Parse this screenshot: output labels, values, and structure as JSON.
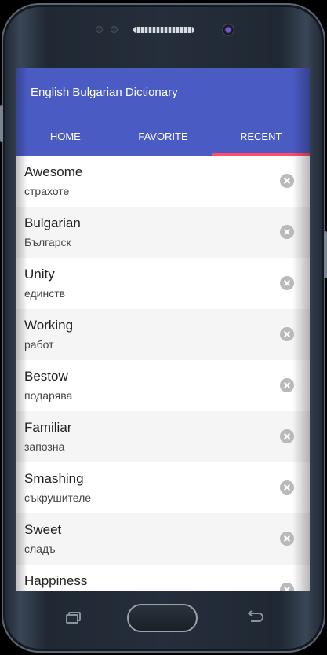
{
  "app": {
    "title": "English Bulgarian Dictionary"
  },
  "tabs": [
    {
      "label": "HOME",
      "active": false
    },
    {
      "label": "FAVORITE",
      "active": false
    },
    {
      "label": "RECENT",
      "active": true
    }
  ],
  "recent": [
    {
      "word": "Awesome",
      "translation": "страхоте"
    },
    {
      "word": "Bulgarian",
      "translation": "Българск"
    },
    {
      "word": "Unity",
      "translation": "единств"
    },
    {
      "word": "Working",
      "translation": "работ"
    },
    {
      "word": "Bestow",
      "translation": "подарява"
    },
    {
      "word": "Familiar",
      "translation": "запозна"
    },
    {
      "word": "Smashing",
      "translation": "съкрушителе"
    },
    {
      "word": "Sweet",
      "translation": "сладъ"
    },
    {
      "word": "Happiness",
      "translation": ""
    }
  ],
  "icons": {
    "remove": "close-circle-icon",
    "recents": "recent-apps-icon",
    "back": "back-arrow-icon"
  },
  "colors": {
    "appbar": "#4a5bc4",
    "tab_indicator": "#ff4c6a",
    "remove_icon": "#b9b9b9"
  }
}
